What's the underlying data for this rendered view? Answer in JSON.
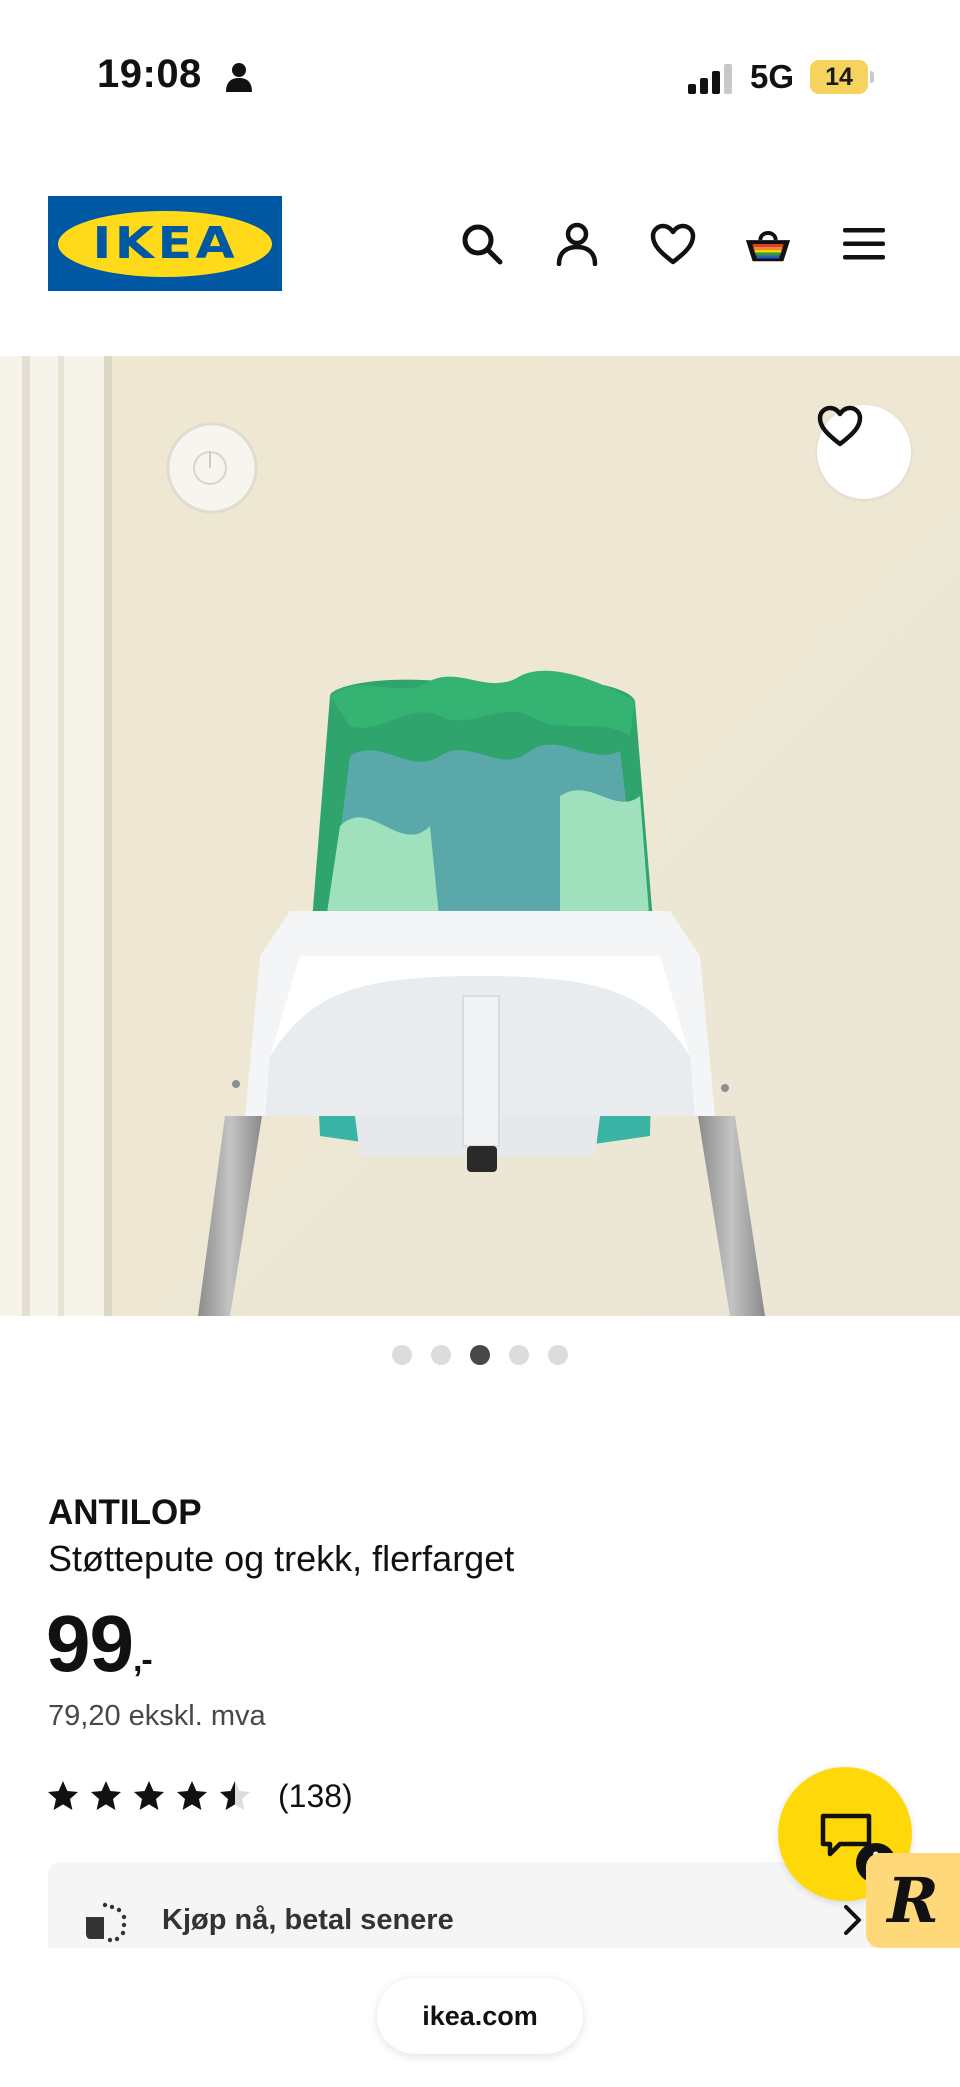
{
  "status_bar": {
    "time": "19:08",
    "network": "5G",
    "battery": "14"
  },
  "header": {
    "logo_text": "IKEA",
    "icons": [
      "search-icon",
      "account-icon",
      "wishlist-icon",
      "cart-icon",
      "menu-icon"
    ]
  },
  "gallery": {
    "image_count": 5,
    "active_index": 2
  },
  "product": {
    "name": "ANTILOP",
    "description": "Støttepute og trekk, flerfarget",
    "price": "99",
    "price_suffix": ",-",
    "price_ex_vat": "79,20 ekskl. mva",
    "rating": 4.5,
    "rating_count": "(138)"
  },
  "bnpl": {
    "label": "Kjøp nå, betal senere"
  },
  "browser": {
    "url": "ikea.com"
  },
  "colors": {
    "brand_blue": "#0058a3",
    "brand_yellow": "#ffda1a",
    "chat_yellow": "#ffd80a"
  }
}
